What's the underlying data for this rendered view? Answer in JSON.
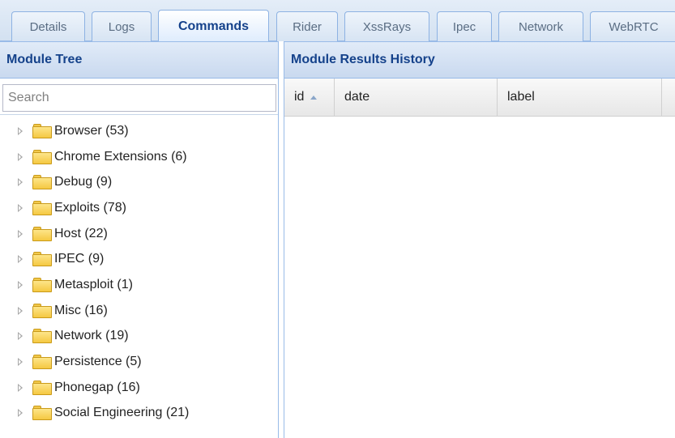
{
  "tabs": [
    {
      "label": "Details",
      "active": false
    },
    {
      "label": "Logs",
      "active": false
    },
    {
      "label": "Commands",
      "active": true
    },
    {
      "label": "Rider",
      "active": false
    },
    {
      "label": "XssRays",
      "active": false
    },
    {
      "label": "Ipec",
      "active": false
    },
    {
      "label": "Network",
      "active": false
    },
    {
      "label": "WebRTC",
      "active": false
    }
  ],
  "module_tree": {
    "title": "Module Tree",
    "search_placeholder": "Search",
    "items": [
      {
        "label": "Browser (53)"
      },
      {
        "label": "Chrome Extensions (6)"
      },
      {
        "label": "Debug (9)"
      },
      {
        "label": "Exploits (78)"
      },
      {
        "label": "Host (22)"
      },
      {
        "label": "IPEC (9)"
      },
      {
        "label": "Metasploit (1)"
      },
      {
        "label": "Misc (16)"
      },
      {
        "label": "Network (19)"
      },
      {
        "label": "Persistence (5)"
      },
      {
        "label": "Phonegap (16)"
      },
      {
        "label": "Social Engineering (21)"
      }
    ]
  },
  "results": {
    "title": "Module Results History",
    "columns": {
      "id": "id",
      "date": "date",
      "label": "label"
    },
    "sort_icon": "sort-ascending-icon"
  },
  "colors": {
    "accent": "#15428b",
    "border": "#99bbe8",
    "header_bg": "#c9d9ef"
  }
}
